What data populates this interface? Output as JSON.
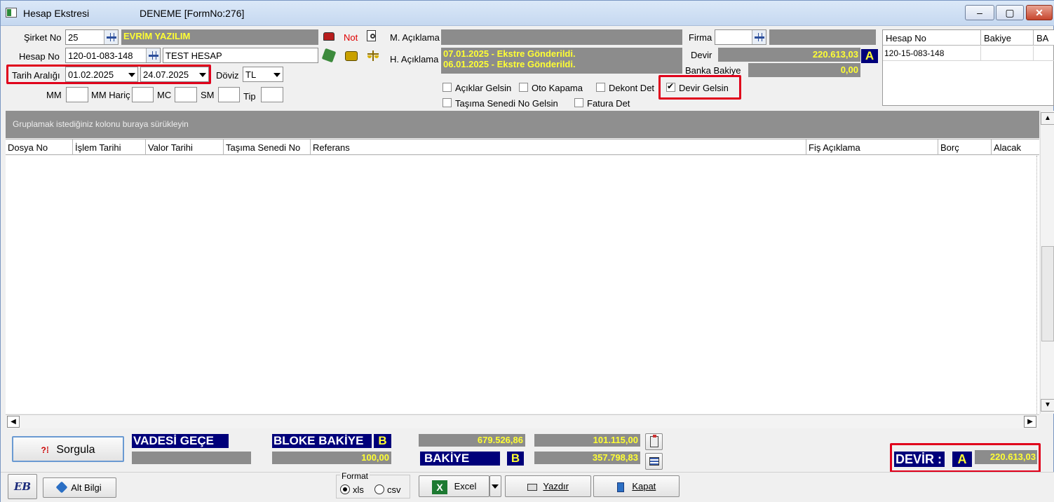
{
  "window": {
    "title": "Hesap Ekstresi",
    "subtitle": "DENEME [FormNo:276]",
    "minimize_label": "–",
    "maximize_label": "▢",
    "close_label": "✕"
  },
  "form": {
    "sirket_label": "Şirket No",
    "sirket_no": "25",
    "sirket_name": "EVRİM YAZILIM",
    "hesap_label": "Hesap No",
    "hesap_no": "120-01-083-148",
    "hesap_name": "TEST HESAP",
    "tarih_label": "Tarih Aralığı",
    "tarih_from": "01.02.2025",
    "tarih_to": "24.07.2025",
    "doviz_label": "Döviz",
    "doviz_value": "TL",
    "mm_label": "MM",
    "mm_haric_label": "MM Hariç",
    "mc_label": "MC",
    "sm_label": "SM",
    "tip_label": "Tip",
    "not_label": "Not",
    "m_aciklama_label": "M. Açıklama",
    "h_aciklama_label": "H. Açıklama",
    "h_aciklama_line1": "07.01.2025 - Ekstre Gönderildi.",
    "h_aciklama_line2": "06.01.2025 - Ekstre Gönderildi.",
    "firma_label": "Firma",
    "devir_label": "Devir",
    "devir_value": "220.613,03",
    "devir_badge": "A",
    "banka_bakiye_label": "Banka Bakiye",
    "banka_bakiye_value": "0,00"
  },
  "checkboxes": {
    "aciklar": "Açıklar Gelsin",
    "oto_kapama": "Oto Kapama",
    "dekont_det": "Dekont Det",
    "devir_gelsin": "Devir Gelsin",
    "tasima_senedi": "Taşıma Senedi No Gelsin",
    "fatura_det": "Fatura Det"
  },
  "side_table": {
    "headers": [
      "Hesap No",
      "Bakiye",
      "BA"
    ],
    "rows": [
      [
        "120-15-083-148",
        "",
        ""
      ]
    ]
  },
  "grid": {
    "group_hint": "Gruplamak istediğiniz kolonu buraya sürükleyin",
    "columns": [
      "Dosya No",
      "İşlem Tarihi",
      "Valor Tarihi",
      "Taşıma Senedi No",
      "Referans",
      "Fiş Açıklama",
      "Borç",
      "Alacak"
    ]
  },
  "footer": {
    "sorgula_label": "Sorgula",
    "vadesi_gecen_label": "VADESİ GEÇE",
    "bloke_bakiye_label": "BLOKE BAKİYE",
    "bloke_badge": "B",
    "bloke_value": "100,00",
    "total_borc": "679.526,86",
    "total_alacak": "101.115,00",
    "bakiye_label": "BAKİYE",
    "bakiye_badge": "B",
    "bakiye_value": "357.798,83",
    "devir_label": "DEVİR :",
    "devir_badge": "A",
    "devir_value": "220.613,03",
    "alt_bilgi_label": "Alt Bilgi",
    "format_label": "Format",
    "format_xls": "xls",
    "format_csv": "csv",
    "excel_label": "Excel",
    "yazdir_label": "Yazdır",
    "kapat_label": "Kapat",
    "logo_text": "EB"
  }
}
